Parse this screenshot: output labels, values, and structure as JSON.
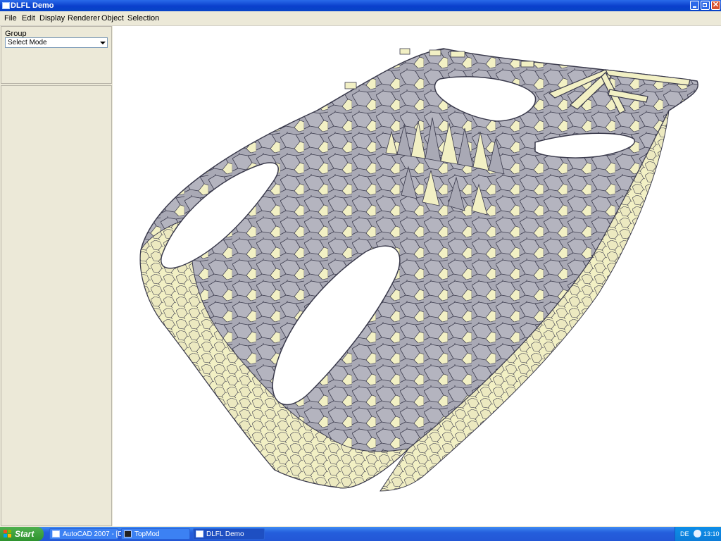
{
  "window": {
    "title": "DLFL Demo"
  },
  "menu": [
    "File",
    "Edit",
    "Display",
    "Renderer",
    "Object",
    "Selection"
  ],
  "panel": {
    "group_label": "Group",
    "mode_select": "Select Mode"
  },
  "taskbar": {
    "start": "Start",
    "tasks": [
      "AutoCAD 2007 - [D:\\...",
      "TopMod",
      "DLFL Demo"
    ],
    "language": "DE",
    "clock": "13:10"
  },
  "colors": {
    "face_light": "#F2F0C4",
    "face_shade": "#A9A9B5",
    "edge": "#3A3A4C"
  }
}
